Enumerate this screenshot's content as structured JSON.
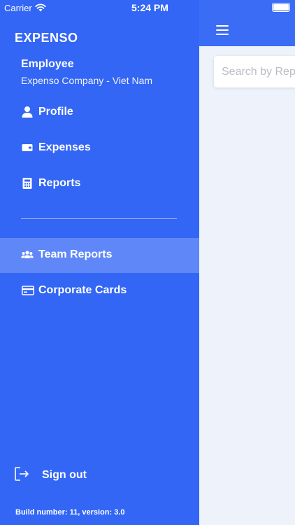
{
  "status_bar": {
    "carrier": "Carrier",
    "time": "5:24 PM"
  },
  "drawer": {
    "brand": "EXPENSO",
    "user": {
      "name": "Employee",
      "company": "Expenso Company - Viet Nam"
    },
    "menu": [
      {
        "label": "Profile",
        "icon": "person-icon"
      },
      {
        "label": "Expenses",
        "icon": "wallet-icon"
      },
      {
        "label": "Reports",
        "icon": "report-icon"
      }
    ],
    "secondary_menu": [
      {
        "label": "Team Reports",
        "icon": "team-icon",
        "active": true
      },
      {
        "label": "Corporate Cards",
        "icon": "card-icon",
        "active": false
      }
    ],
    "sign_out": "Sign out",
    "build": "Build number: 11, version: 3.0"
  },
  "main": {
    "search_placeholder": "Search by Report"
  },
  "colors": {
    "primary": "#3366f5",
    "header": "#3b6cf6",
    "content_bg": "#eef2fa",
    "active_item": "#5c86f7"
  }
}
